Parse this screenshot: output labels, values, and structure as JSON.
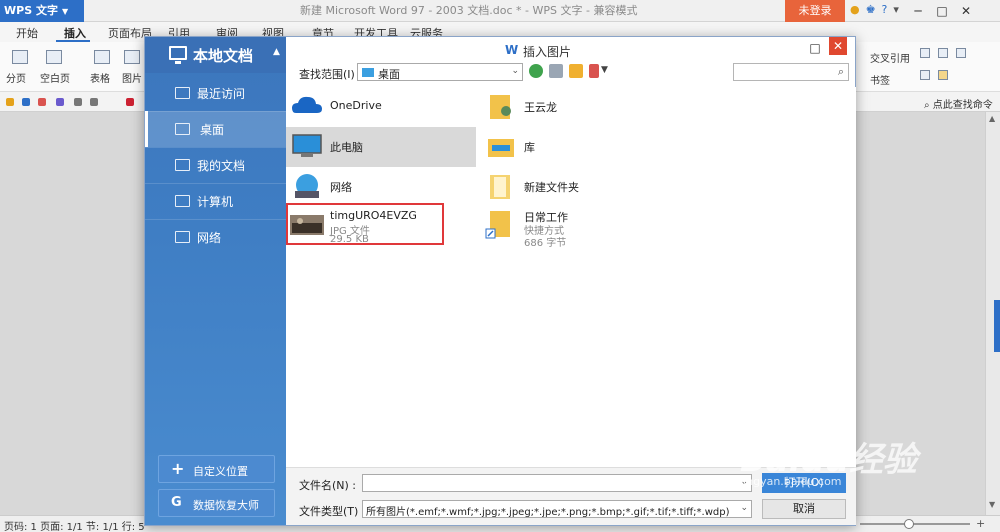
{
  "app": {
    "name": "WPS 文字",
    "doc_title": "新建 Microsoft Word 97 - 2003 文档.doc * - WPS 文字 - 兼容模式",
    "login": "未登录",
    "win_min": "─",
    "win_max": "□",
    "win_close": "✕"
  },
  "menu": [
    "开始",
    "插入",
    "页面布局",
    "引用",
    "审阅",
    "视图",
    "章节",
    "开发工具",
    "云服务"
  ],
  "ribbon": {
    "page_break": "分页",
    "blank_page": "空白页",
    "table": "表格",
    "picture": "图片",
    "cross_ref": "交叉引用",
    "bookmark": "书签",
    "find_cmd": "点此查找命令"
  },
  "status": {
    "text": "页码: 1   页面: 1/1   节: 1/1   行: 5"
  },
  "dialog": {
    "title": "插入图片",
    "sidebar_title": "本地文档",
    "sidebar_items": [
      "最近访问",
      "桌面",
      "我的文档",
      "计算机",
      "网络"
    ],
    "custom_location": "自定义位置",
    "data_recovery": "数据恢复大师",
    "look_in_label": "查找范围(I) :",
    "look_in_value": "桌面",
    "files": [
      {
        "name": "OneDrive",
        "sub1": "",
        "sub2": ""
      },
      {
        "name": "此电脑",
        "sub1": "",
        "sub2": ""
      },
      {
        "name": "网络",
        "sub1": "",
        "sub2": ""
      },
      {
        "name": "timgURO4EVZG",
        "sub1": "JPG 文件",
        "sub2": "29.5 KB"
      },
      {
        "name": "王云龙",
        "sub1": "",
        "sub2": ""
      },
      {
        "name": "库",
        "sub1": "",
        "sub2": ""
      },
      {
        "name": "新建文件夹",
        "sub1": "",
        "sub2": ""
      },
      {
        "name": "日常工作",
        "sub1": "快捷方式",
        "sub2": "686 字节"
      }
    ],
    "filename_label": "文件名(N) :",
    "filename_value": "",
    "filetype_label": "文件类型(T) :",
    "filetype_value": "所有图片(*.emf;*.wmf;*.jpg;*.jpeg;*.jpe;*.png;*.bmp;*.gif;*.tif;*.tiff;*.wdp)",
    "open": "打开(O)",
    "cancel": "取消"
  },
  "watermark": {
    "main": "Baidu经验",
    "sub": "jingyan.baidu.com"
  }
}
